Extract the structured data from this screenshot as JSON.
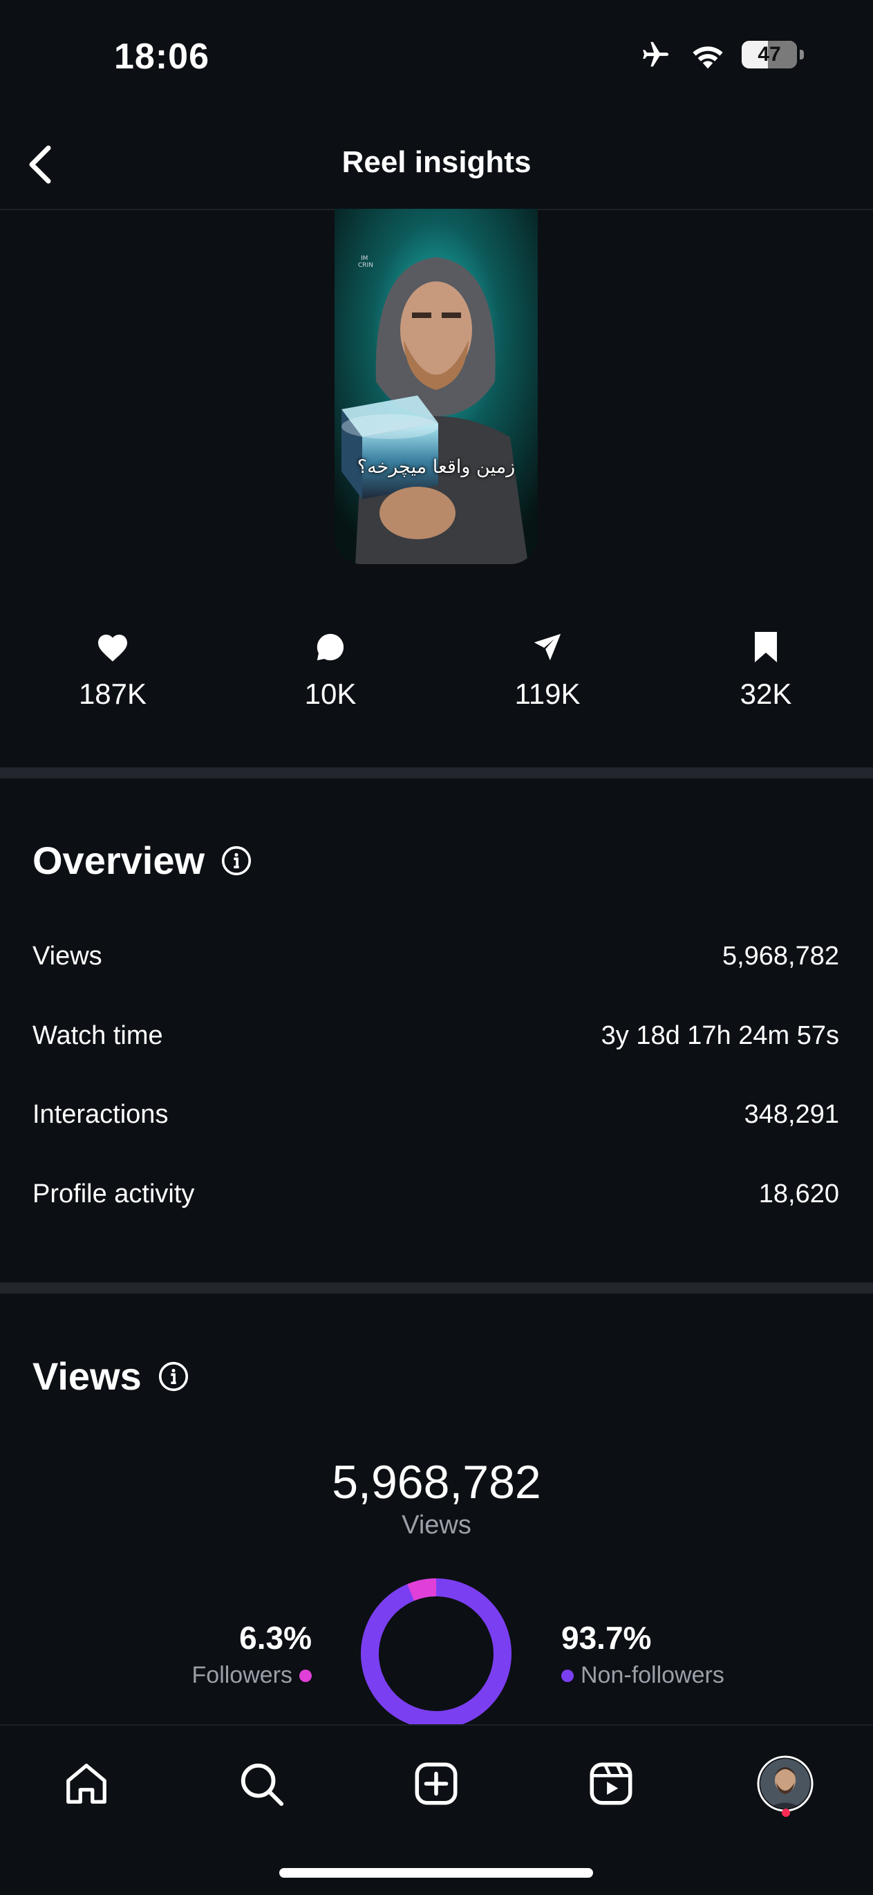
{
  "status_bar": {
    "time": "18:06",
    "battery": "47",
    "battery_level": 0.47
  },
  "header": {
    "title": "Reel insights"
  },
  "reel": {
    "caption": "زمین واقعا میچرخه؟"
  },
  "stats": {
    "likes": "187K",
    "comments": "10K",
    "shares": "119K",
    "saves": "32K"
  },
  "overview": {
    "title": "Overview",
    "rows": [
      {
        "label": "Views",
        "value": "5,968,782"
      },
      {
        "label": "Watch time",
        "value": "3y 18d 17h 24m 57s"
      },
      {
        "label": "Interactions",
        "value": "348,291"
      },
      {
        "label": "Profile activity",
        "value": "18,620"
      }
    ]
  },
  "views": {
    "title": "Views",
    "total": "5,968,782",
    "total_label": "Views",
    "followers_pct": "6.3%",
    "followers_label": "Followers",
    "nonfollowers_pct": "93.7%",
    "nonfollowers_label": "Non-followers",
    "followers_fraction": 0.063,
    "colors": {
      "followers": "#e040d8",
      "nonfollowers": "#7b3ff2"
    }
  },
  "tabbar": {
    "items": [
      "home-icon",
      "search-icon",
      "create-icon",
      "reels-icon",
      "profile-avatar"
    ]
  }
}
